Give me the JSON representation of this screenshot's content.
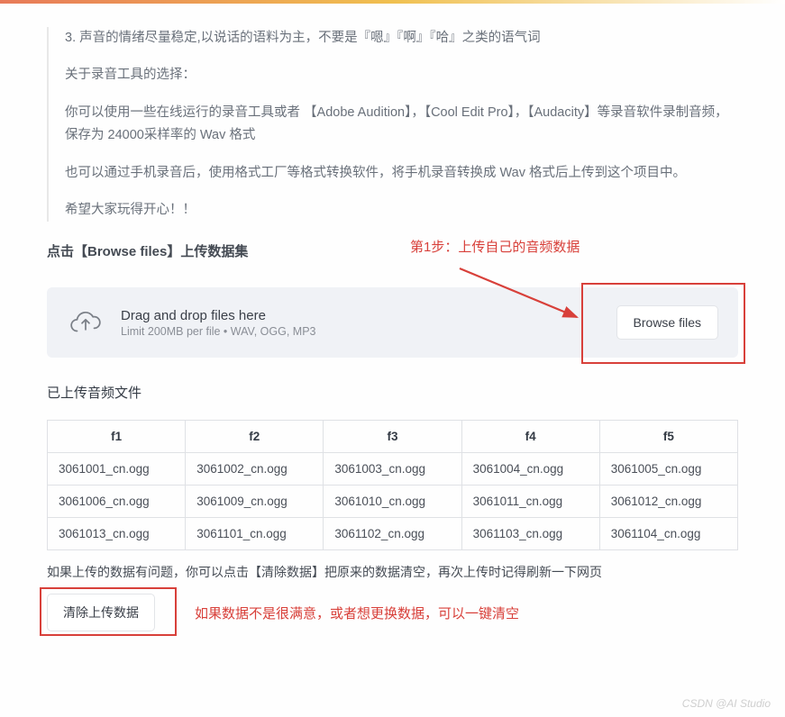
{
  "instructions": {
    "list_item_3": "3.   声音的情绪尽量稳定,以说话的语料为主，不要是『嗯』『啊』『哈』之类的语气词",
    "para_tool_choice": "关于录音工具的选择：",
    "para_tools": "你可以使用一些在线运行的录音工具或者 【Adobe Audition】，【Cool Edit Pro】，【Audacity】等录音软件录制音频，保存为 24000采样率的 Wav 格式",
    "para_mobile": "也可以通过手机录音后，使用格式工厂等格式转换软件，将手机录音转换成 Wav 格式后上传到这个项目中。",
    "para_enjoy": "希望大家玩得开心！！"
  },
  "section_heading": "点击【Browse files】上传数据集",
  "uploader": {
    "dnd_text": "Drag and drop files here",
    "limit_text": "Limit 200MB per file • WAV, OGG, MP3",
    "browse_label": "Browse files"
  },
  "annotation1": "第1步：上传自己的音频数据",
  "uploaded_heading": "已上传音频文件",
  "table": {
    "headers": [
      "f1",
      "f2",
      "f3",
      "f4",
      "f5"
    ],
    "rows": [
      [
        "3061001_cn.ogg",
        "3061002_cn.ogg",
        "3061003_cn.ogg",
        "3061004_cn.ogg",
        "3061005_cn.ogg"
      ],
      [
        "3061006_cn.ogg",
        "3061009_cn.ogg",
        "3061010_cn.ogg",
        "3061011_cn.ogg",
        "3061012_cn.ogg"
      ],
      [
        "3061013_cn.ogg",
        "3061101_cn.ogg",
        "3061102_cn.ogg",
        "3061103_cn.ogg",
        "3061104_cn.ogg"
      ]
    ]
  },
  "hint_text": "如果上传的数据有问题，你可以点击【清除数据】把原来的数据清空，再次上传时记得刷新一下网页",
  "clear_button": "清除上传数据",
  "annotation2": "如果数据不是很满意，或者想更换数据，可以一键清空",
  "watermark": "CSDN @AI Studio"
}
